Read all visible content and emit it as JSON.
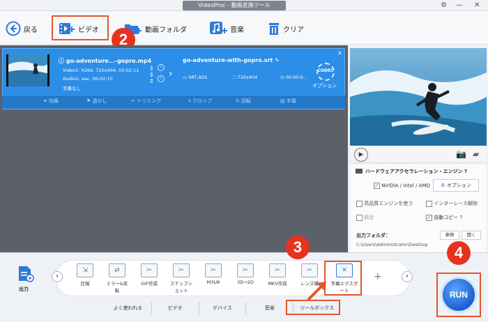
{
  "window": {
    "title": "VideoProc - 動画変換ツール"
  },
  "toolbar": {
    "back": "戻る",
    "video": "ビデオ",
    "folder": "動画フォルダ",
    "music": "音楽",
    "clear": "クリア"
  },
  "file": {
    "source_name": "go-adventure...-gopro.mp4",
    "video_info": "Video1: h264, 720x404, 00:02:11",
    "audio_info": "Audio1: aac, 00:02:10",
    "subtitle_info": "字幕なし",
    "output_name": "go-adventure-with-gopro.srt",
    "output_format": "SRT,ASS",
    "output_res": "720x404",
    "output_time": "00:00:0...",
    "option_label": "オプション"
  },
  "edit_actions": [
    "効果",
    "透かし",
    "トリミング",
    "クロップ",
    "回転",
    "字幕"
  ],
  "hw": {
    "title": "ハードウェアアクセラレーション・エンジン",
    "nvidia": "NVIDIA / Intel / AMD",
    "option": "オプション",
    "hq_engine": "高品質エンジンを使う",
    "deinterlace": "インターレース解除",
    "merge": "結合",
    "auto_copy": "自動コピー",
    "output_folder_label": "出力フォルダ：",
    "browse": "参照",
    "open": "開く",
    "output_path": "C:\\Users\\Administrator\\Desktop"
  },
  "bottom": {
    "output_label": "出力",
    "tools": [
      {
        "label": "圧縮"
      },
      {
        "label": "ミラー&反転"
      },
      {
        "label": "GIF作成"
      },
      {
        "label": "スナップショット"
      },
      {
        "label": "M3U8"
      },
      {
        "label": "3D→2D"
      },
      {
        "label": "MKV作成"
      },
      {
        "label": "レンズ補"
      },
      {
        "label": "字幕エクスポート"
      }
    ],
    "tabs": [
      "よく使われる",
      "ビデオ",
      "デバイス",
      "音楽",
      "ツールボックス"
    ],
    "run": "RUN"
  },
  "badges": {
    "b2": "2",
    "b3": "3",
    "b4": "4"
  },
  "colors": {
    "accent_blue": "#2c8ee6",
    "annotation_red": "#e8321e",
    "frame_orange": "#e0572d"
  }
}
